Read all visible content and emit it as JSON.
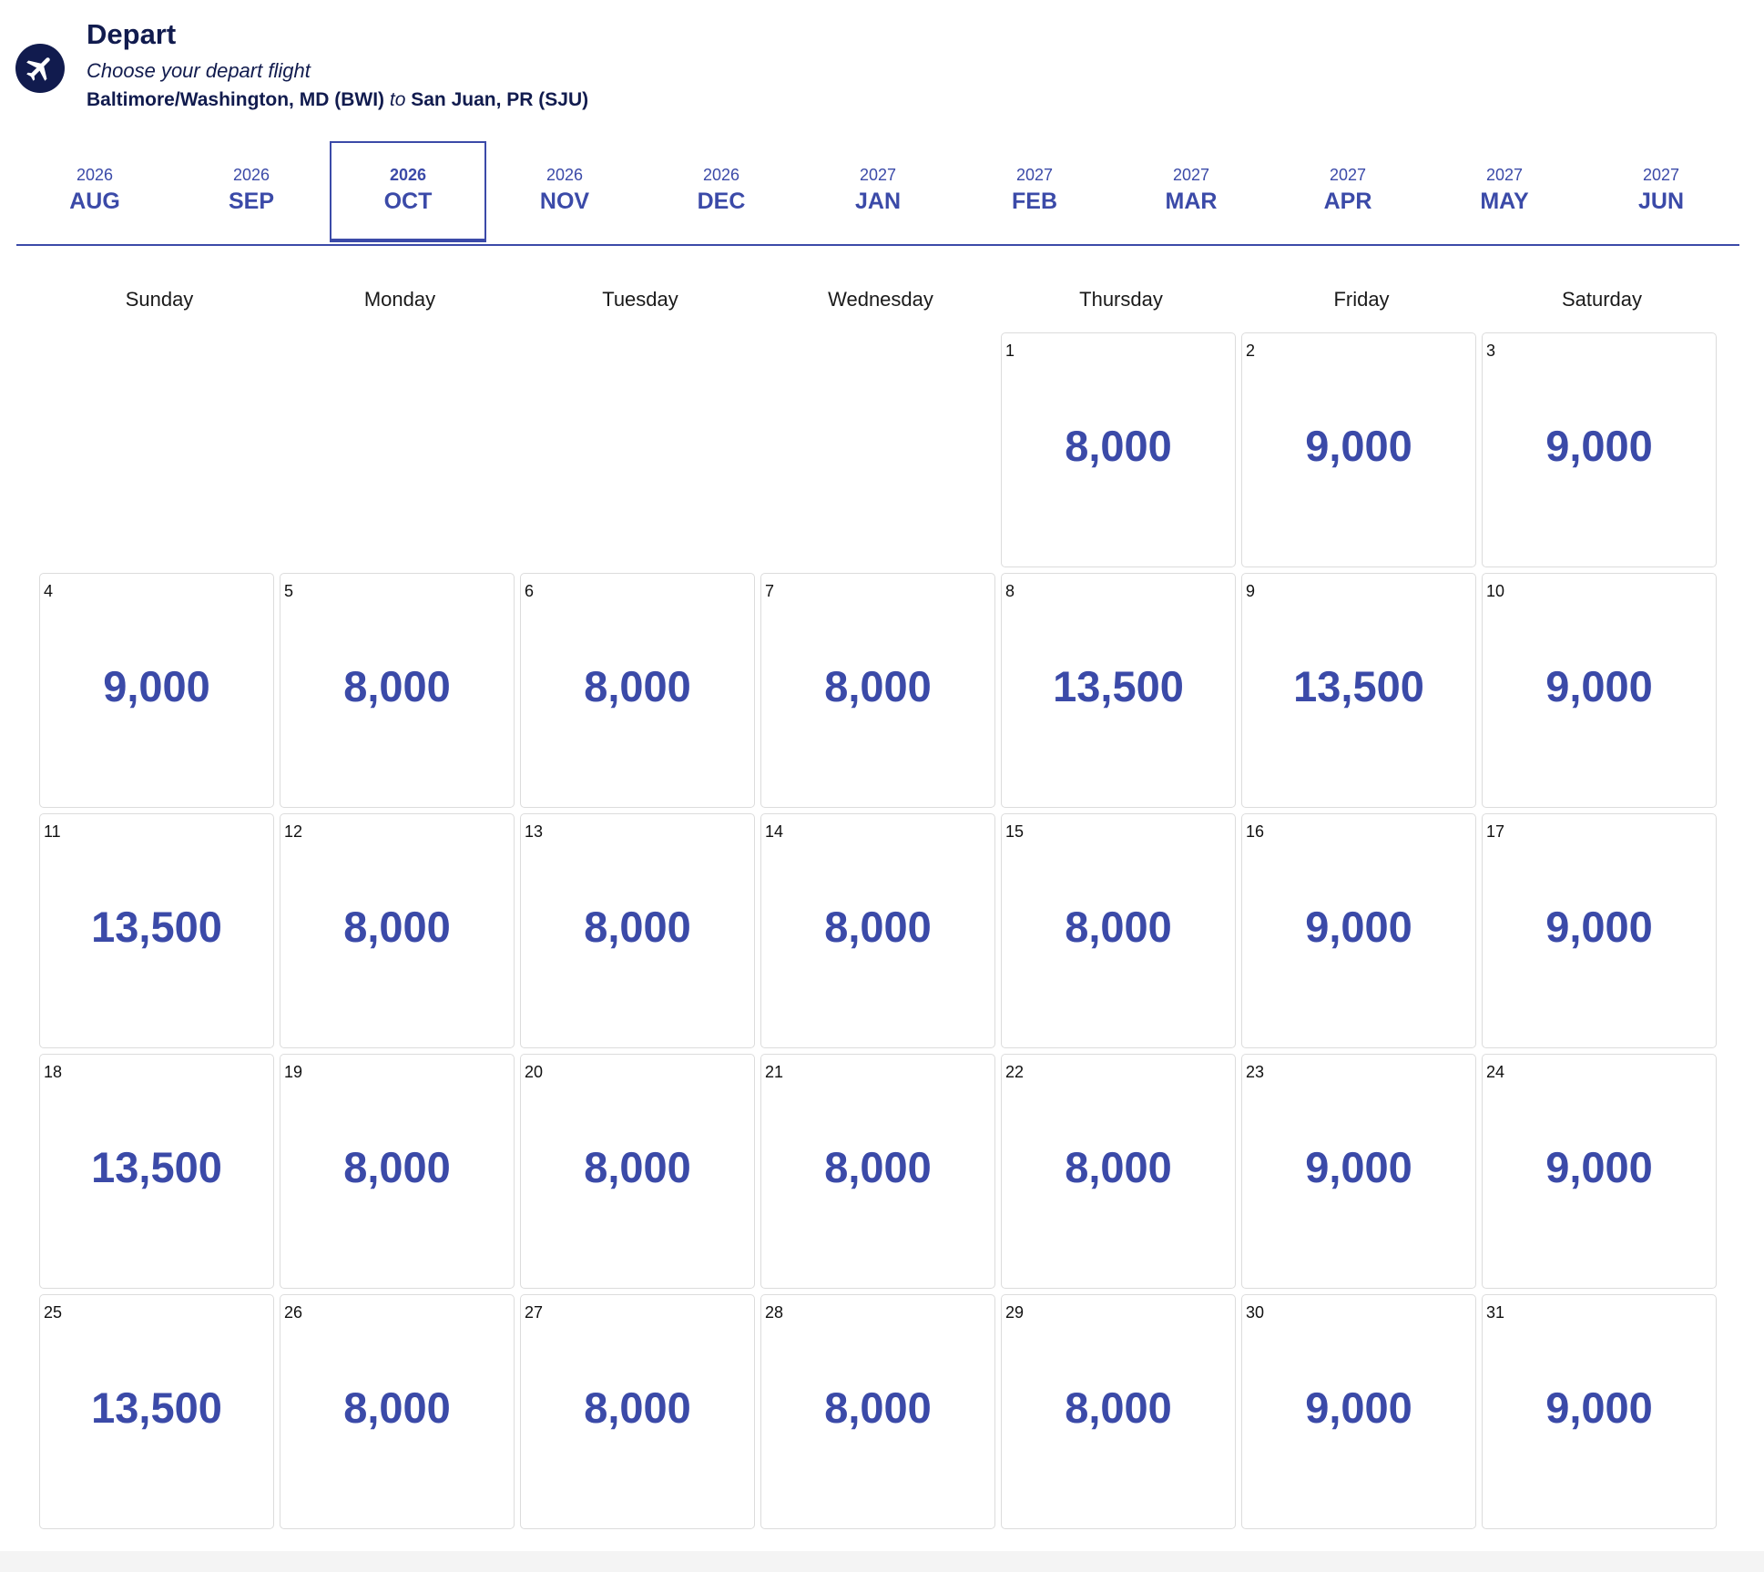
{
  "header": {
    "title": "Depart",
    "subtitle": "Choose your depart flight",
    "origin": "Baltimore/Washington, MD (BWI)",
    "connector": "to",
    "destination": "San Juan, PR (SJU)",
    "icon": "airplane-icon"
  },
  "month_tabs": [
    {
      "year": "2026",
      "month": "AUG"
    },
    {
      "year": "2026",
      "month": "SEP"
    },
    {
      "year": "2026",
      "month": "OCT",
      "active": true
    },
    {
      "year": "2026",
      "month": "NOV"
    },
    {
      "year": "2026",
      "month": "DEC"
    },
    {
      "year": "2027",
      "month": "JAN"
    },
    {
      "year": "2027",
      "month": "FEB"
    },
    {
      "year": "2027",
      "month": "MAR"
    },
    {
      "year": "2027",
      "month": "APR"
    },
    {
      "year": "2027",
      "month": "MAY"
    },
    {
      "year": "2027",
      "month": "JUN"
    }
  ],
  "weekdays": [
    "Sunday",
    "Monday",
    "Tuesday",
    "Wednesday",
    "Thursday",
    "Friday",
    "Saturday"
  ],
  "calendar": {
    "leading_empty_days": 4,
    "days": [
      {
        "day": "1",
        "fare": "8,000"
      },
      {
        "day": "2",
        "fare": "9,000"
      },
      {
        "day": "3",
        "fare": "9,000"
      },
      {
        "day": "4",
        "fare": "9,000"
      },
      {
        "day": "5",
        "fare": "8,000"
      },
      {
        "day": "6",
        "fare": "8,000"
      },
      {
        "day": "7",
        "fare": "8,000"
      },
      {
        "day": "8",
        "fare": "13,500"
      },
      {
        "day": "9",
        "fare": "13,500"
      },
      {
        "day": "10",
        "fare": "9,000"
      },
      {
        "day": "11",
        "fare": "13,500"
      },
      {
        "day": "12",
        "fare": "8,000"
      },
      {
        "day": "13",
        "fare": "8,000"
      },
      {
        "day": "14",
        "fare": "8,000"
      },
      {
        "day": "15",
        "fare": "8,000"
      },
      {
        "day": "16",
        "fare": "9,000"
      },
      {
        "day": "17",
        "fare": "9,000"
      },
      {
        "day": "18",
        "fare": "13,500"
      },
      {
        "day": "19",
        "fare": "8,000"
      },
      {
        "day": "20",
        "fare": "8,000"
      },
      {
        "day": "21",
        "fare": "8,000"
      },
      {
        "day": "22",
        "fare": "8,000"
      },
      {
        "day": "23",
        "fare": "9,000"
      },
      {
        "day": "24",
        "fare": "9,000"
      },
      {
        "day": "25",
        "fare": "13,500"
      },
      {
        "day": "26",
        "fare": "8,000"
      },
      {
        "day": "27",
        "fare": "8,000"
      },
      {
        "day": "28",
        "fare": "8,000"
      },
      {
        "day": "29",
        "fare": "8,000"
      },
      {
        "day": "30",
        "fare": "9,000"
      },
      {
        "day": "31",
        "fare": "9,000"
      }
    ]
  },
  "colors": {
    "brand_dark": "#111b4e",
    "accent": "#3b4aa8"
  }
}
